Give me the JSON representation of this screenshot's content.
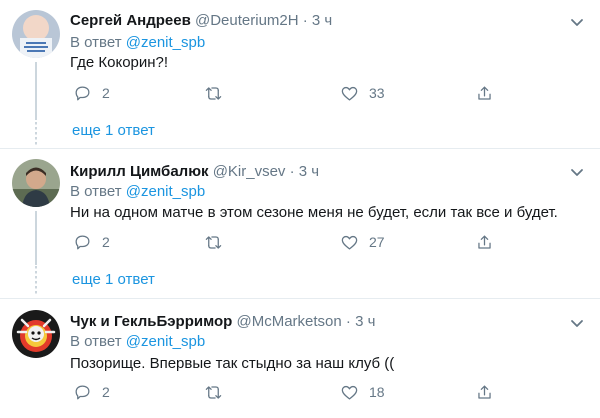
{
  "tweets": [
    {
      "name": "Сергей Андреев",
      "handle": "@Deuterium2H",
      "dot": "·",
      "time": "3 ч",
      "reply_prefix": "В ответ",
      "reply_mention": "@zenit_spb",
      "text": "Где Кокорин?!",
      "replies": "2",
      "retweets": "",
      "likes": "33",
      "avatar_icon": "baby-photo-avatar"
    },
    {
      "name": "Кирилл Цимбалюк",
      "handle": "@Kir_vsev",
      "dot": "·",
      "time": "3 ч",
      "reply_prefix": "В ответ",
      "reply_mention": "@zenit_spb",
      "text": "Ни на одном матче в этом сезоне меня не будет, если так все и будет.",
      "replies": "2",
      "retweets": "",
      "likes": "27",
      "avatar_icon": "man-photo-avatar"
    },
    {
      "name": "Чук и ГекльБэрримор",
      "handle": "@McMarketson",
      "dot": "·",
      "time": "3 ч",
      "reply_prefix": "В ответ",
      "reply_mention": "@zenit_spb",
      "text": "Позорище. Впервые так стыдно за наш клуб ((",
      "replies": "2",
      "retweets": "",
      "likes": "18",
      "avatar_icon": "clown-avatar"
    }
  ],
  "show_more": [
    "еще 1 ответ",
    "еще 1 ответ"
  ],
  "colors": {
    "link": "#1b95e0",
    "secondary": "#657786",
    "primary": "#14171a",
    "divider": "#e6ecf0"
  },
  "icons": [
    "caret-down-icon",
    "reply-icon",
    "retweet-icon",
    "like-icon",
    "share-icon"
  ]
}
